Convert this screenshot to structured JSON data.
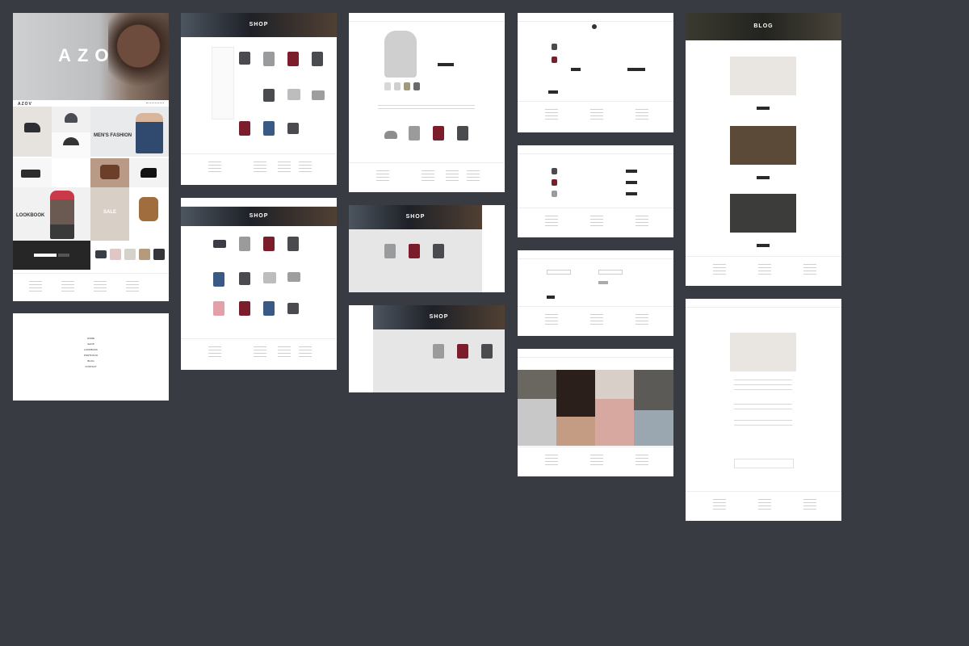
{
  "home": {
    "brand": "AZOV",
    "mens_collection": "MEN'S FASHION",
    "lookbook": "LOOKBOOK",
    "sale": "SALE"
  },
  "menu_overlay": {
    "items": [
      "HOME",
      "SHOP",
      "LOOKBOOK",
      "PORTFOLIO",
      "BLOG",
      "CONTACT"
    ]
  },
  "shop": {
    "banner_title": "SHOP"
  },
  "blog": {
    "banner_title": "BLOG"
  },
  "colors": {
    "background": "#393b42",
    "accent_red": "#7c1d2b",
    "dark": "#2a2a2a"
  }
}
